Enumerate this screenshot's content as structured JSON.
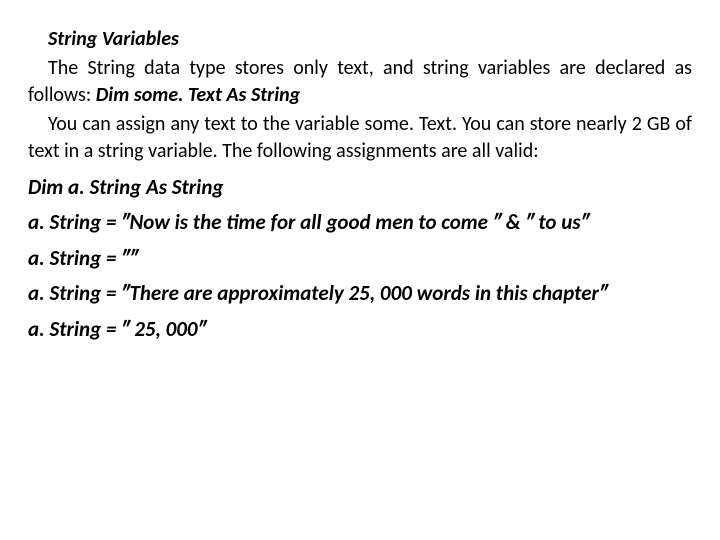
{
  "heading": "String Variables",
  "para1_a": "The String data type stores only text, and string variables are declared as follows: ",
  "para1_b": "Dim some. Text As String",
  "para2": "You can assign any text to the variable some. Text. You can store nearly 2 GB of text in a string variable. The following assignments are all valid:",
  "code": {
    "l1": "Dim a. String As String",
    "l2": "a. String = ″Now is the time for all good men to come ″ & ″ to us″",
    "l3": "a. String = ″″",
    "l4": "a. String = ″There are approximately 25, 000 words in this chapter″",
    "l5": "a. String = ″ 25, 000″"
  }
}
